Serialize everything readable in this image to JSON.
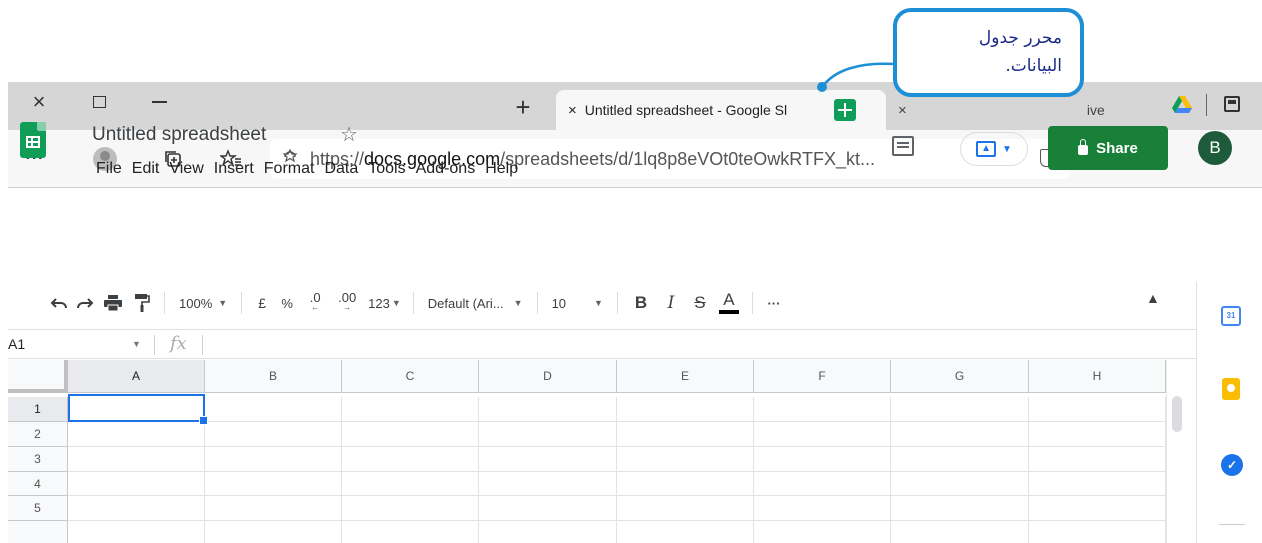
{
  "callout": {
    "line1": "محرر جدول",
    "line2": "البيانات."
  },
  "browser": {
    "window_controls": {
      "close": "×",
      "maximize": "maximize-icon",
      "minimize": "minimize-icon"
    },
    "new_tab": "+",
    "active_tab": {
      "title": "Untitled spreadsheet - Google Sl",
      "close": "×"
    },
    "inactive_tab": {
      "title": "ive",
      "close": "×"
    },
    "address": {
      "scheme": "https://",
      "host": "docs.google.com",
      "path": "/spreadsheets/d/1lq8p8eVOt0teOwkRTFX_kt...",
      "more": "···"
    }
  },
  "sheets": {
    "title": "Untitled spreadsheet",
    "menu": [
      "File",
      "Edit",
      "View",
      "Insert",
      "Format",
      "Data",
      "Tools",
      "Add-ons",
      "Help"
    ],
    "share_label": "Share",
    "avatar_initial": "B",
    "accent": "#188038",
    "brand": "#0f9d58"
  },
  "toolbar": {
    "zoom": "100%",
    "currency": "£",
    "percent": "%",
    "decrease_decimals": ".0",
    "increase_decimals": ".00",
    "more_formats": "123",
    "font": "Default (Ari...",
    "font_size": "10",
    "bold": "B",
    "italic": "I",
    "strikethrough": "S",
    "text_color": "A",
    "more": "···"
  },
  "formula_bar": {
    "name_box": "A1",
    "fx": "fx"
  },
  "grid": {
    "columns": [
      "A",
      "B",
      "C",
      "D",
      "E",
      "F",
      "G",
      "H"
    ],
    "rows": [
      "1",
      "2",
      "3",
      "4",
      "5"
    ],
    "selected_cell": "A1"
  },
  "side_panel": {
    "calendar_label": "31"
  }
}
